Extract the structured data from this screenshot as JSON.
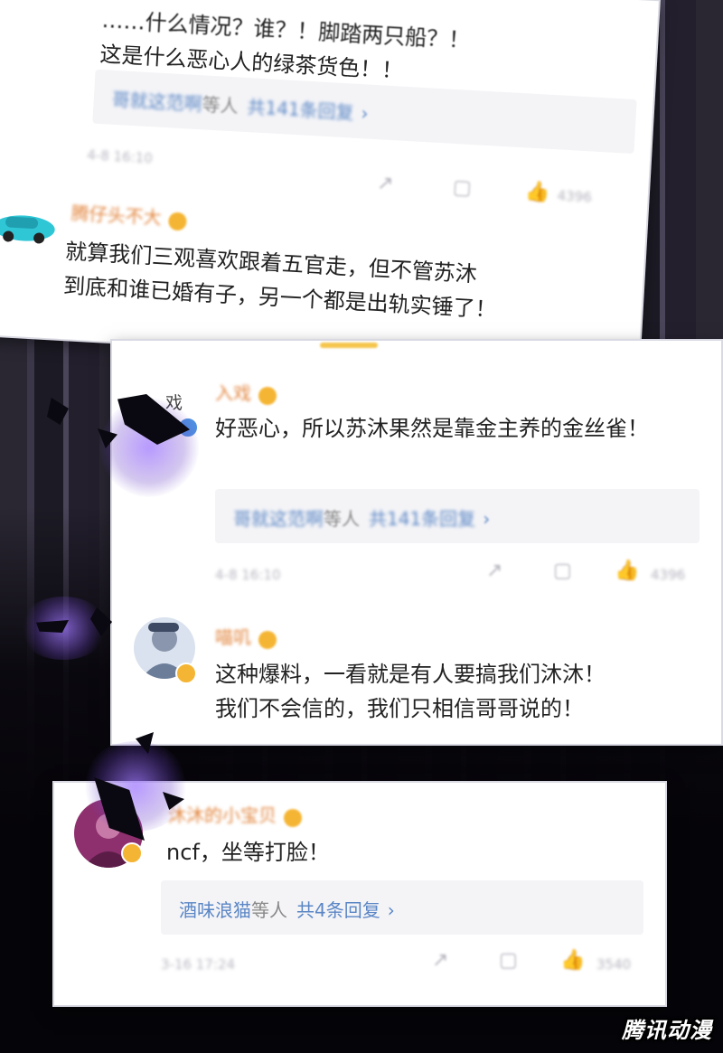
{
  "colors": {
    "accent_name": "#e2863f",
    "link": "#5a86c5",
    "badge": "#f5b534",
    "verified": "#f5b534",
    "panel": "#ffffff"
  },
  "panel1": {
    "body_lines": [
      "……什么情况？谁？！脚踏两只船？！",
      "这是什么恶心人的绿茶货色！！"
    ],
    "reply_blur": "哥就这范啊",
    "reply_mid": "等人",
    "reply_count": "共141条回复",
    "meta": "4-8 16:10",
    "like_count": "4396",
    "comment2": {
      "name": "腾仔头不大",
      "lines": [
        "就算我们三观喜欢跟着五官走，但不管苏沐",
        "到底和谁已婚有子，另一个都是出轨实锤了！"
      ]
    }
  },
  "panel2": {
    "comment1": {
      "avatar_text": "入 戏",
      "name": "入戏",
      "text": "好恶心，所以苏沐果然是靠金主养的金丝雀！",
      "reply_blur": "哥就这范啊",
      "reply_mid": "等人",
      "reply_count": "共141条回复",
      "meta": "4-8 16:10",
      "like_count": "4396"
    },
    "comment2": {
      "name": "喵叽",
      "lines": [
        "这种爆料，一看就是有人要搞我们沐沐！",
        "我们不会信的，我们只相信哥哥说的！"
      ]
    }
  },
  "panel3": {
    "name": "沐沐的小宝贝",
    "text": "ncf，坐等打脸！",
    "reply_user": "酒味浪猫",
    "reply_mid": "等人",
    "reply_count": "共4条回复",
    "meta": "3-16 17:24",
    "like_count": "3540"
  },
  "icons": {
    "share": "share-icon",
    "comment": "comment-icon",
    "like": "thumbs-up-icon",
    "chevron": "chevron-right-icon"
  },
  "watermark": "腾讯动漫"
}
